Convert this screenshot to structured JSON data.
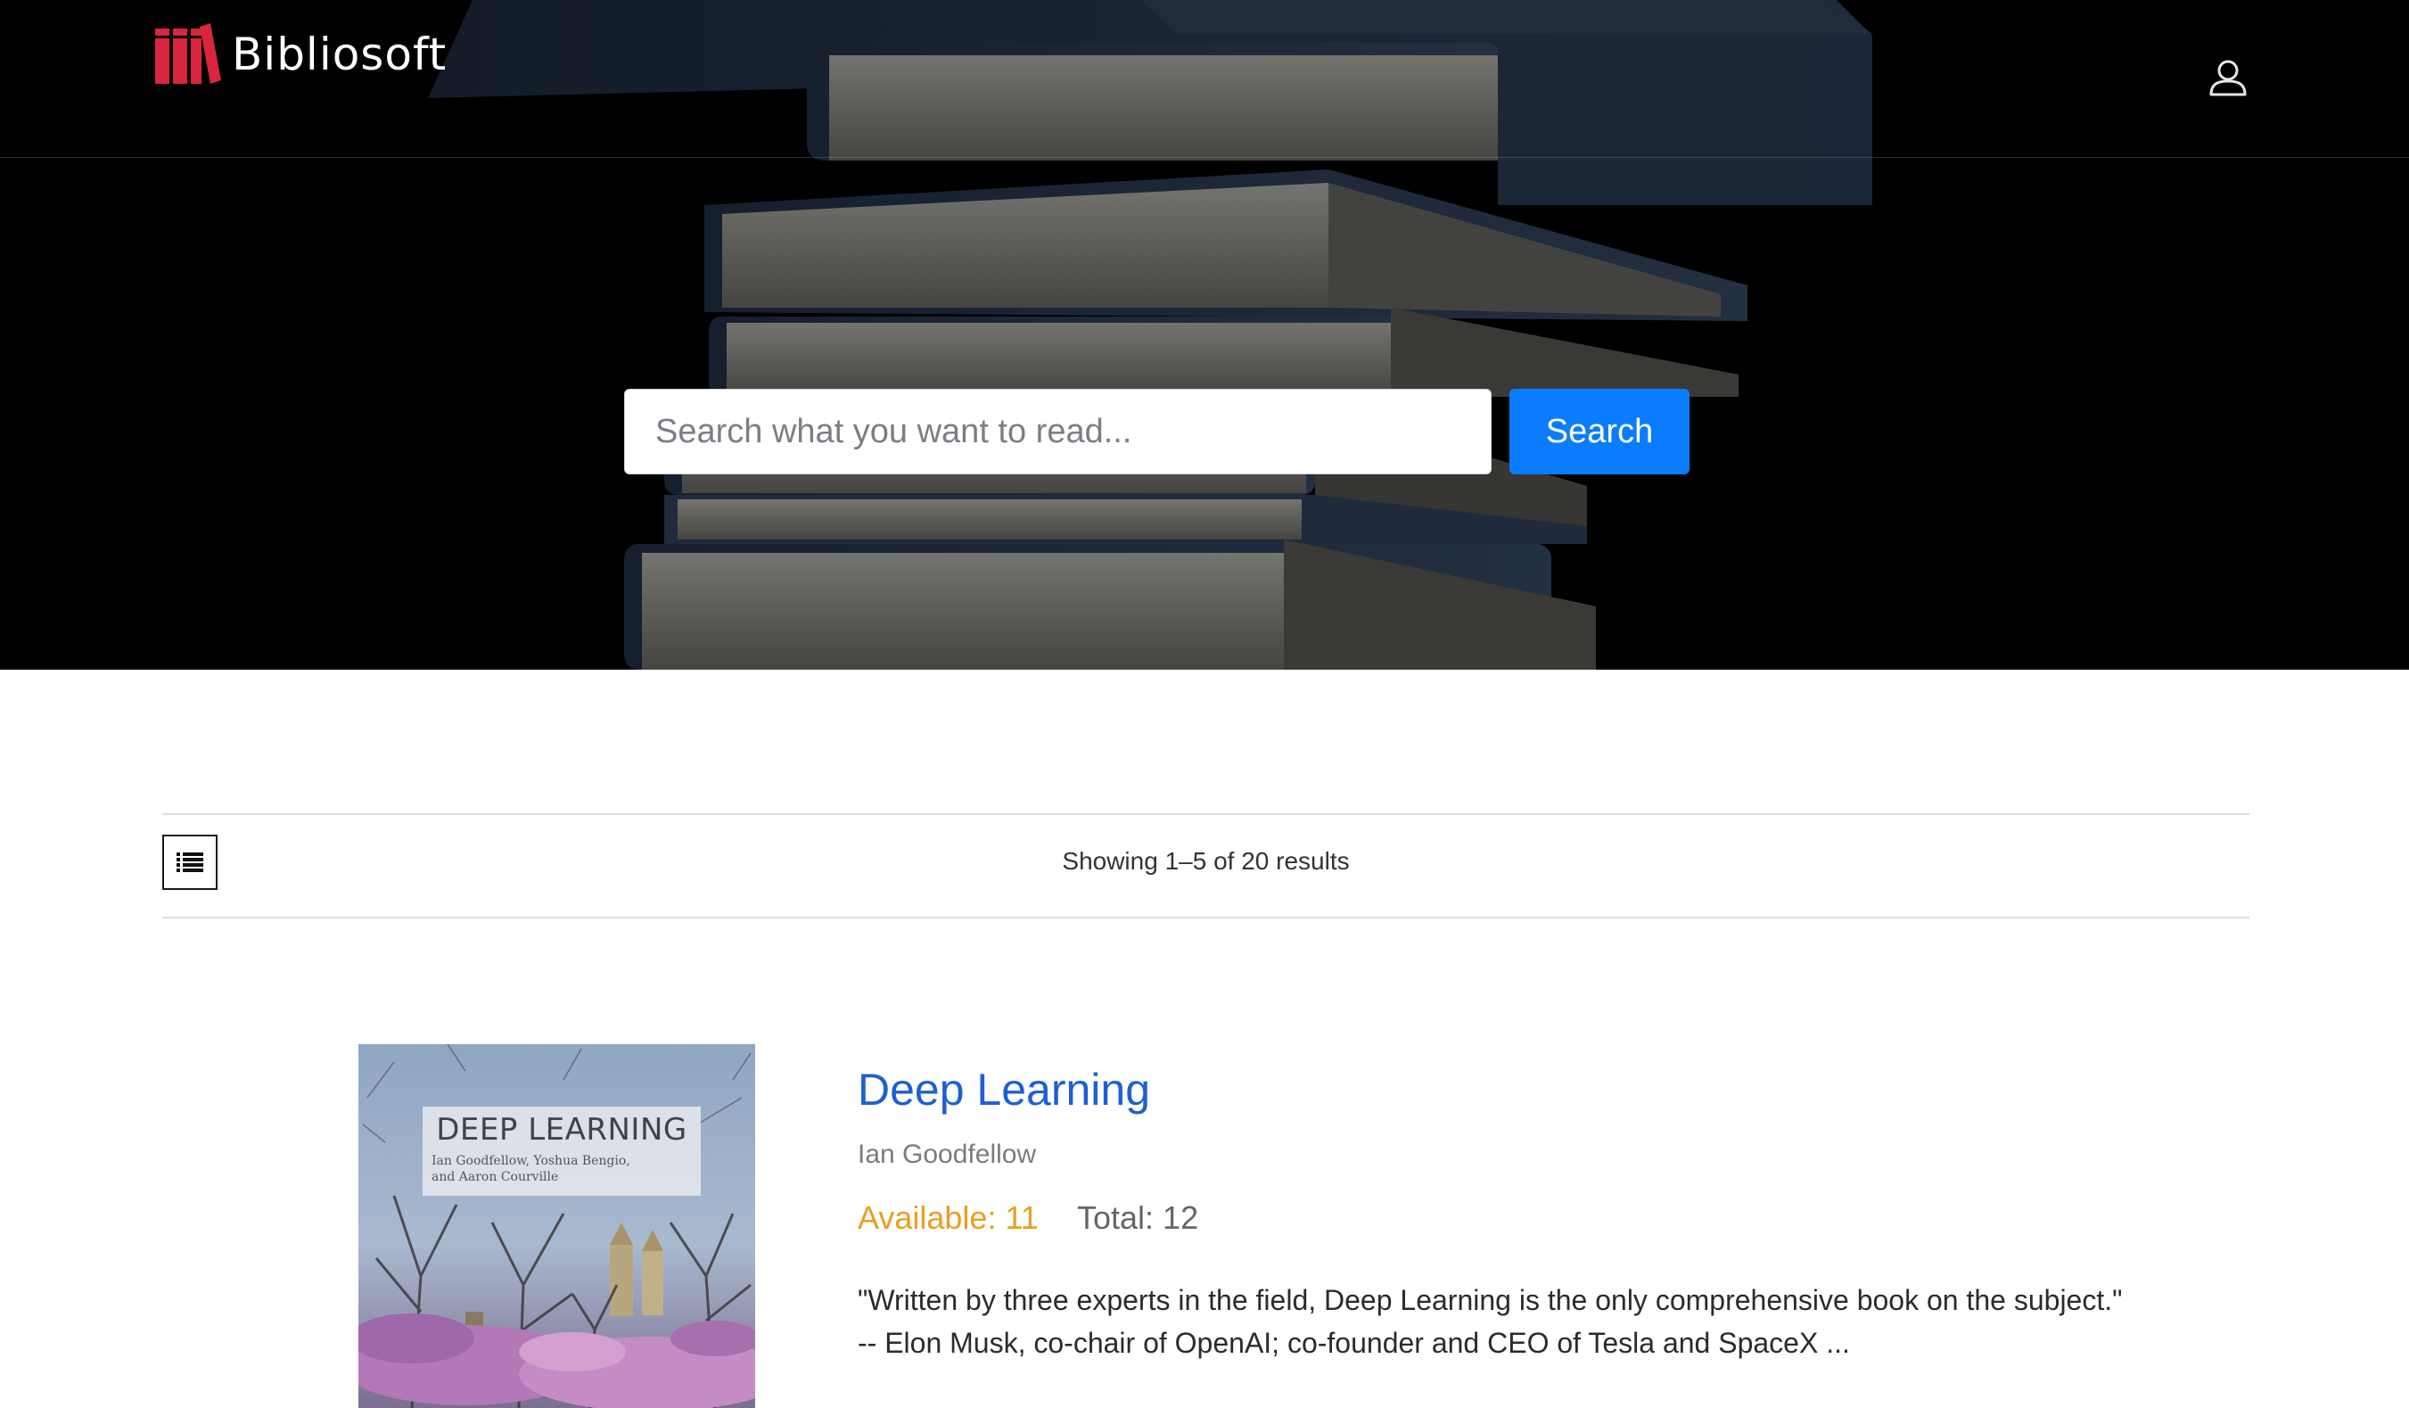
{
  "header": {
    "brand_name": "Bibliosoft",
    "logo_icon": "books-logo-icon",
    "user_icon": "user-icon",
    "accent_color": "#d7263d"
  },
  "hero": {
    "search_placeholder": "Search what you want to read...",
    "search_button_label": "Search",
    "search_button_color": "#0a7cff"
  },
  "results": {
    "view_icon": "list-icon",
    "count_text": "Showing 1–5 of 20 results"
  },
  "books": [
    {
      "title": "Deep Learning",
      "author": "Ian Goodfellow",
      "available": "Available: 11",
      "total": "Total: 12",
      "cover": {
        "title": "DEEP LEARNING",
        "authors_line1": "Ian Goodfellow, Yoshua Bengio,",
        "authors_line2": "and Aaron Courville"
      },
      "description_line1": "\"Written by three experts in the field, Deep Learning is the only comprehensive book on the subject.\"",
      "description_line2": "-- Elon Musk, co-chair of OpenAI; co-founder and CEO of Tesla and SpaceX ..."
    }
  ]
}
